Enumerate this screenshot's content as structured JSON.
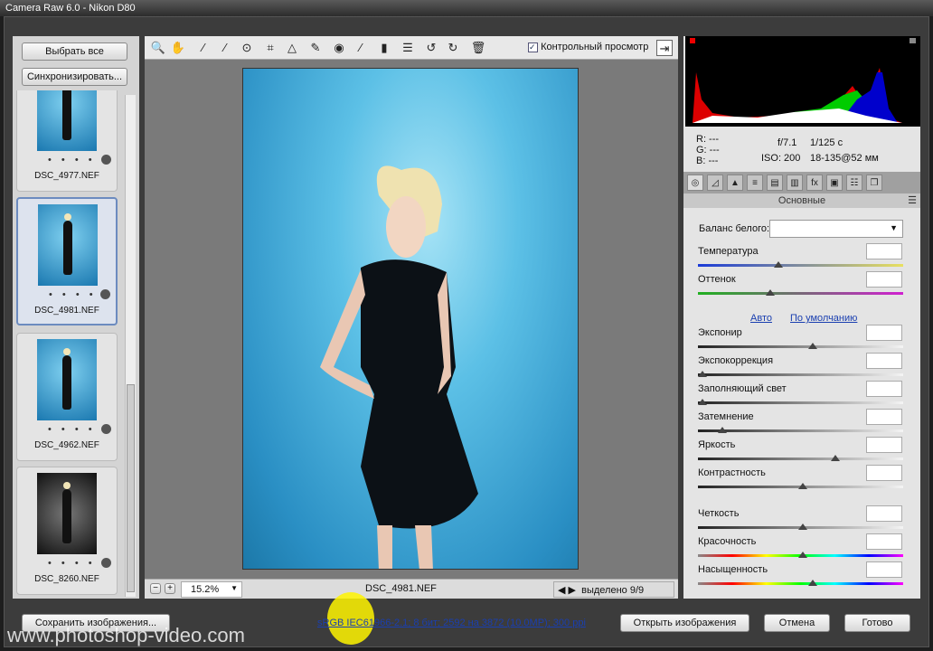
{
  "window": {
    "title": "Camera Raw 6.0  -  Nikon D80"
  },
  "filmstrip": {
    "select_all": "Выбрать все",
    "synchronize": "Синхронизировать...",
    "items": [
      {
        "name": "DSC_4977.NEF",
        "dots": "• • • • •",
        "selected": false
      },
      {
        "name": "DSC_4981.NEF",
        "dots": "• • • • •",
        "selected": true
      },
      {
        "name": "DSC_4962.NEF",
        "dots": "• • • • •",
        "selected": false
      },
      {
        "name": "DSC_8260.NEF",
        "dots": "• • • • •",
        "selected": false
      }
    ]
  },
  "toolbar": {
    "tools": [
      "zoom-tool",
      "hand-tool",
      "white-balance-tool",
      "color-sampler-tool",
      "target-adjustment-tool",
      "crop-tool",
      "straighten-tool",
      "spot-removal-tool",
      "red-eye-tool",
      "adjustment-brush",
      "graduated-filter",
      "preferences",
      "rotate-left",
      "rotate-right",
      "trash"
    ],
    "preview_label": "Контрольный просмотр",
    "preview_checked": true
  },
  "status": {
    "zoom": "15.2%",
    "filename": "DSC_4981.NEF",
    "selected": "выделено 9/9"
  },
  "info": {
    "r": "R:  ---",
    "g": "G:  ---",
    "b": "B:  ---",
    "aperture": "f/7.1",
    "shutter": "1/125 с",
    "iso": "ISO: 200",
    "lens": "18-135@52 мм"
  },
  "panel": {
    "title": "Основные",
    "wb_label": "Баланс белого:",
    "wb_value": "",
    "auto": "Авто",
    "default": "По умолчанию",
    "sliders": [
      {
        "label": "Температура",
        "value": "",
        "pos": 0.38,
        "type": "temp"
      },
      {
        "label": "Оттенок",
        "value": "",
        "pos": 0.34,
        "type": "tint"
      },
      {
        "label": "Экспонир",
        "value": "",
        "pos": 0.55,
        "type": "gray"
      },
      {
        "label": "Экспокоррекция",
        "value": "",
        "pos": 0.0,
        "type": "gray"
      },
      {
        "label": "Заполняющий свет",
        "value": "",
        "pos": 0.0,
        "type": "gray"
      },
      {
        "label": "Затемнение",
        "value": "",
        "pos": 0.1,
        "type": "gray"
      },
      {
        "label": "Яркость",
        "value": "",
        "pos": 0.66,
        "type": "gray"
      },
      {
        "label": "Контрастность",
        "value": "",
        "pos": 0.5,
        "type": "gray"
      },
      {
        "label": "Четкость",
        "value": "",
        "pos": 0.5,
        "type": "gray"
      },
      {
        "label": "Красочность",
        "value": "",
        "pos": 0.5,
        "type": "sat"
      },
      {
        "label": "Насыщенность",
        "value": "",
        "pos": 0.55,
        "type": "sat"
      }
    ]
  },
  "footer": {
    "save": "Сохранить изображения...",
    "workflow": "sRGB IEC61966-2.1; 8 бит; 2592 на 3872 (10.0MP); 300 ppi",
    "open": "Открыть изображения",
    "cancel": "Отмена",
    "done": "Готово",
    "watermark": "www.photoshop-video.com"
  }
}
